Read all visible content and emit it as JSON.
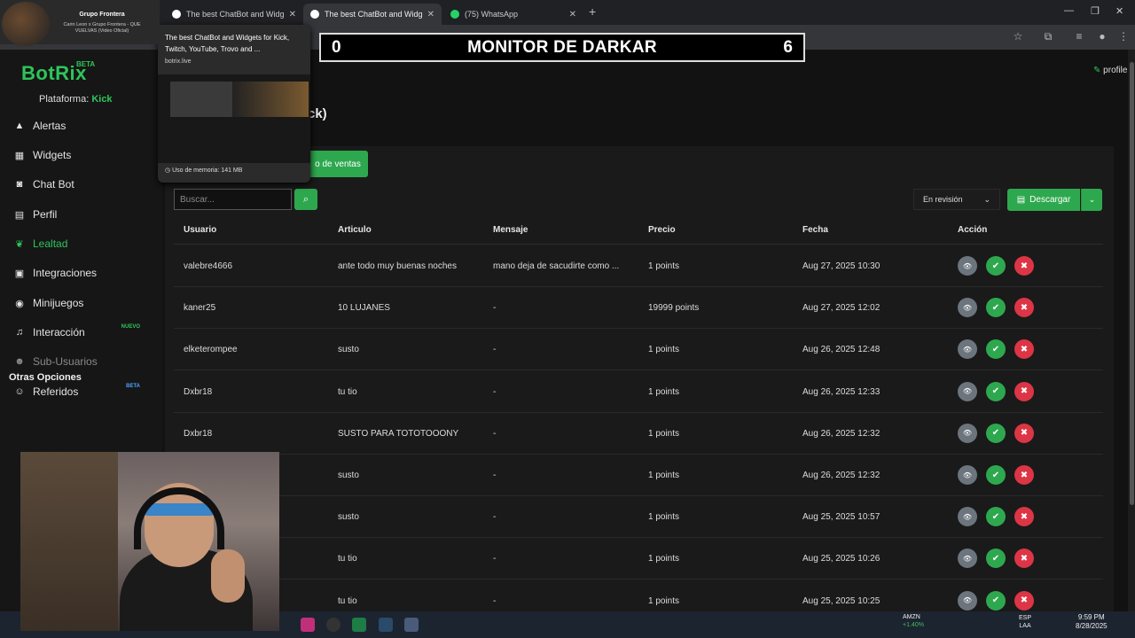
{
  "browser": {
    "tabs": [
      {
        "title": "The best ChatBot and Widgets"
      },
      {
        "title": "The best ChatBot and Widgets"
      },
      {
        "title": "(75) WhatsApp"
      }
    ]
  },
  "overlay": {
    "left_value": "0",
    "title": "MONITOR DE DARKAR",
    "right_value": "6"
  },
  "now_playing": {
    "artist": "Grupo Frontera",
    "song": "Carin Leon x Grupo Frontera - QUE VUELVAS (Video Oficial)"
  },
  "tooltip": {
    "title": "The best ChatBot and Widgets for Kick, Twitch, YouTube, Trovo and ...",
    "domain": "botrix.live",
    "memory": "Uso de memoria: 141 MB"
  },
  "sidebar": {
    "logo": "BotRix",
    "logo_badge": "BETA",
    "platform_label": "Plataforma:",
    "platform_value": "Kick",
    "items": [
      {
        "label": "Alertas",
        "icon": "warning-icon"
      },
      {
        "label": "Widgets",
        "icon": "grid-icon"
      },
      {
        "label": "Chat Bot",
        "icon": "robot-icon"
      },
      {
        "label": "Perfil",
        "icon": "id-card-icon"
      },
      {
        "label": "Lealtad",
        "icon": "leaf-icon",
        "active": true
      },
      {
        "label": "Integraciones",
        "icon": "plug-icon"
      },
      {
        "label": "Minijuegos",
        "icon": "gamepad-icon"
      },
      {
        "label": "Interacción",
        "icon": "music-icon",
        "badge": "NUEVO"
      },
      {
        "label": "Sub-Usuarios",
        "icon": "users-icon",
        "dim": true
      },
      {
        "label": "Referidos",
        "icon": "user-group-icon",
        "badge": "BETA"
      }
    ],
    "section_title": "Otras Opciones"
  },
  "header": {
    "profile_label": "profile"
  },
  "main": {
    "title_fragment": "ck)",
    "tab_label": "o de ventas",
    "search_placeholder": "Buscar...",
    "status_select": "En revisión",
    "download_label": "Descargar"
  },
  "table": {
    "columns": [
      "Usuario",
      "Articulo",
      "Mensaje",
      "Precio",
      "Fecha",
      "Acción"
    ],
    "rows": [
      {
        "usuario": "valebre4666",
        "articulo": "ante todo muy buenas noches",
        "mensaje": "mano deja de sacudirte como ...",
        "precio": "1 points",
        "fecha": "Aug 27, 2025 10:30"
      },
      {
        "usuario": "kaner25",
        "articulo": "10 LUJANES",
        "mensaje": "-",
        "precio": "19999 points",
        "fecha": "Aug 27, 2025 12:02"
      },
      {
        "usuario": "elketerompee",
        "articulo": "susto",
        "mensaje": "-",
        "precio": "1 points",
        "fecha": "Aug 26, 2025 12:48"
      },
      {
        "usuario": "Dxbr18",
        "articulo": "tu tio",
        "mensaje": "-",
        "precio": "1 points",
        "fecha": "Aug 26, 2025 12:33"
      },
      {
        "usuario": "Dxbr18",
        "articulo": "SUSTO PARA TOTOTOOONY",
        "mensaje": "-",
        "precio": "1 points",
        "fecha": "Aug 26, 2025 12:32"
      },
      {
        "usuario": "",
        "articulo": "susto",
        "mensaje": "-",
        "precio": "1 points",
        "fecha": "Aug 26, 2025 12:32"
      },
      {
        "usuario": "",
        "articulo": "susto",
        "mensaje": "-",
        "precio": "1 points",
        "fecha": "Aug 25, 2025 10:57"
      },
      {
        "usuario": "",
        "articulo": "tu tio",
        "mensaje": "-",
        "precio": "1 points",
        "fecha": "Aug 25, 2025 10:26"
      },
      {
        "usuario": "",
        "articulo": "tu tio",
        "mensaje": "-",
        "precio": "1 points",
        "fecha": "Aug 25, 2025 10:25"
      }
    ]
  },
  "taskbar": {
    "stock_symbol": "AMZN",
    "stock_change": "+1.40%",
    "lang_1": "ESP",
    "lang_2": "LAA",
    "time": "9:59 PM",
    "date": "8/28/2025"
  },
  "colors": {
    "accent": "#2ea84f",
    "danger": "#dc3545",
    "muted": "#6c757d"
  }
}
